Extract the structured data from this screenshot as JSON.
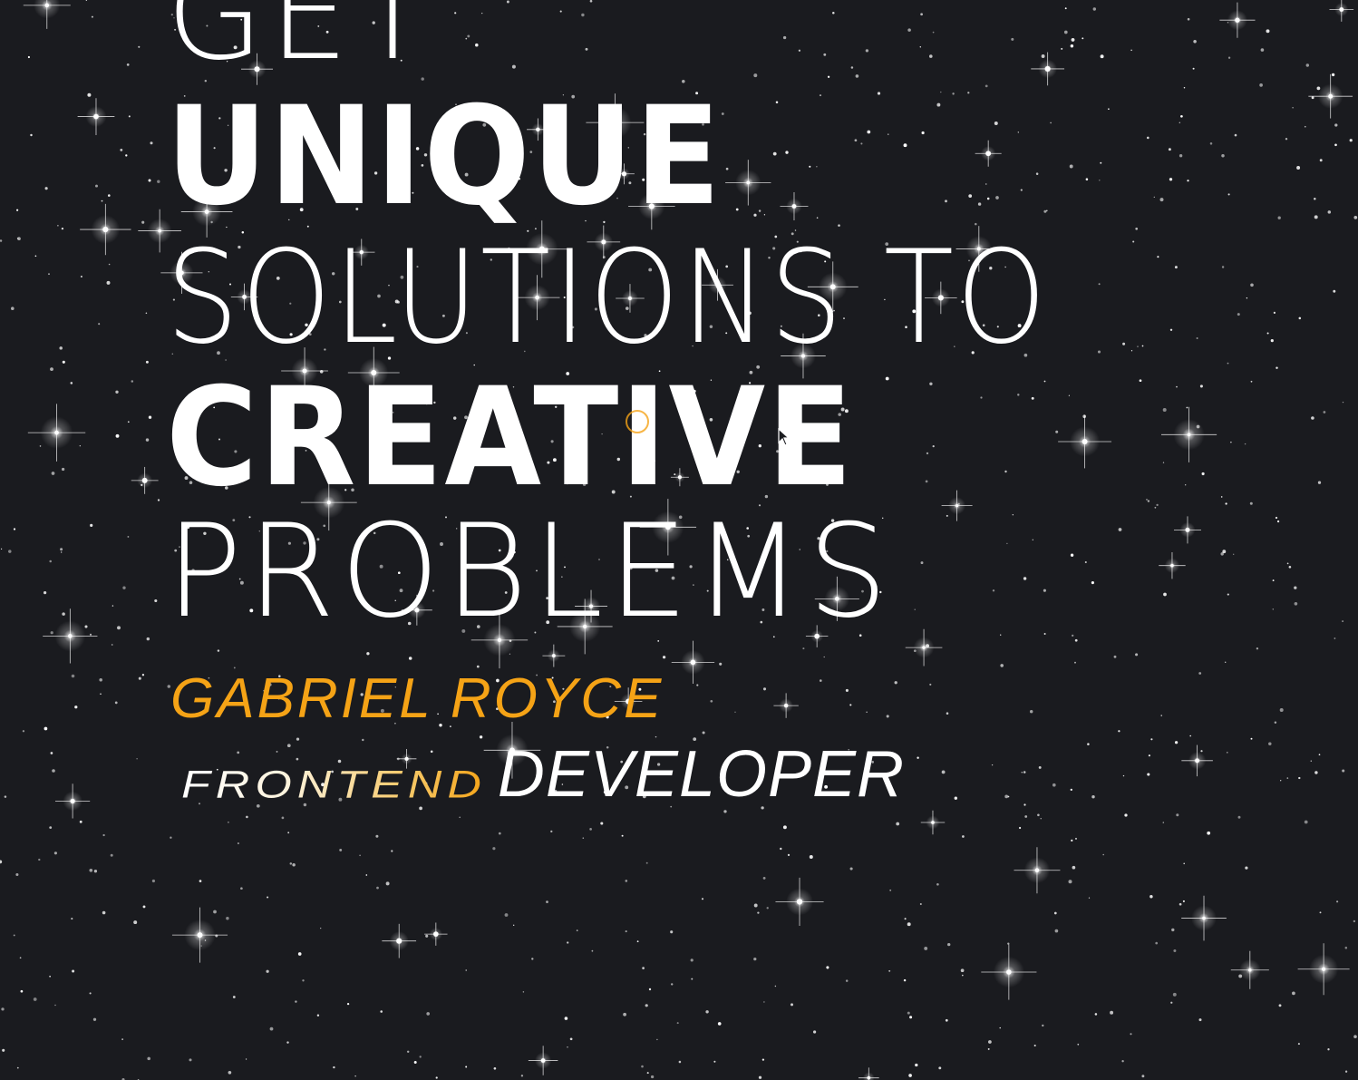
{
  "hero": {
    "line1": "GET",
    "line2": "UNIQUE",
    "line3": "SOLUTIONS TO",
    "line4": "CREATIVE",
    "line5": "PROBLEMS"
  },
  "profile": {
    "name": "GABRIEL ROYCE",
    "role_part1": "FRONTEND",
    "role_part2": "DEVELOPER"
  },
  "colors": {
    "background": "#1a1b1f",
    "accent": "#f5a316",
    "text": "#ffffff"
  },
  "icons": {
    "cursor": "mouse-pointer-icon",
    "cursor_follower": "cursor-ring-icon",
    "stars": "star-sparkle-icon"
  }
}
